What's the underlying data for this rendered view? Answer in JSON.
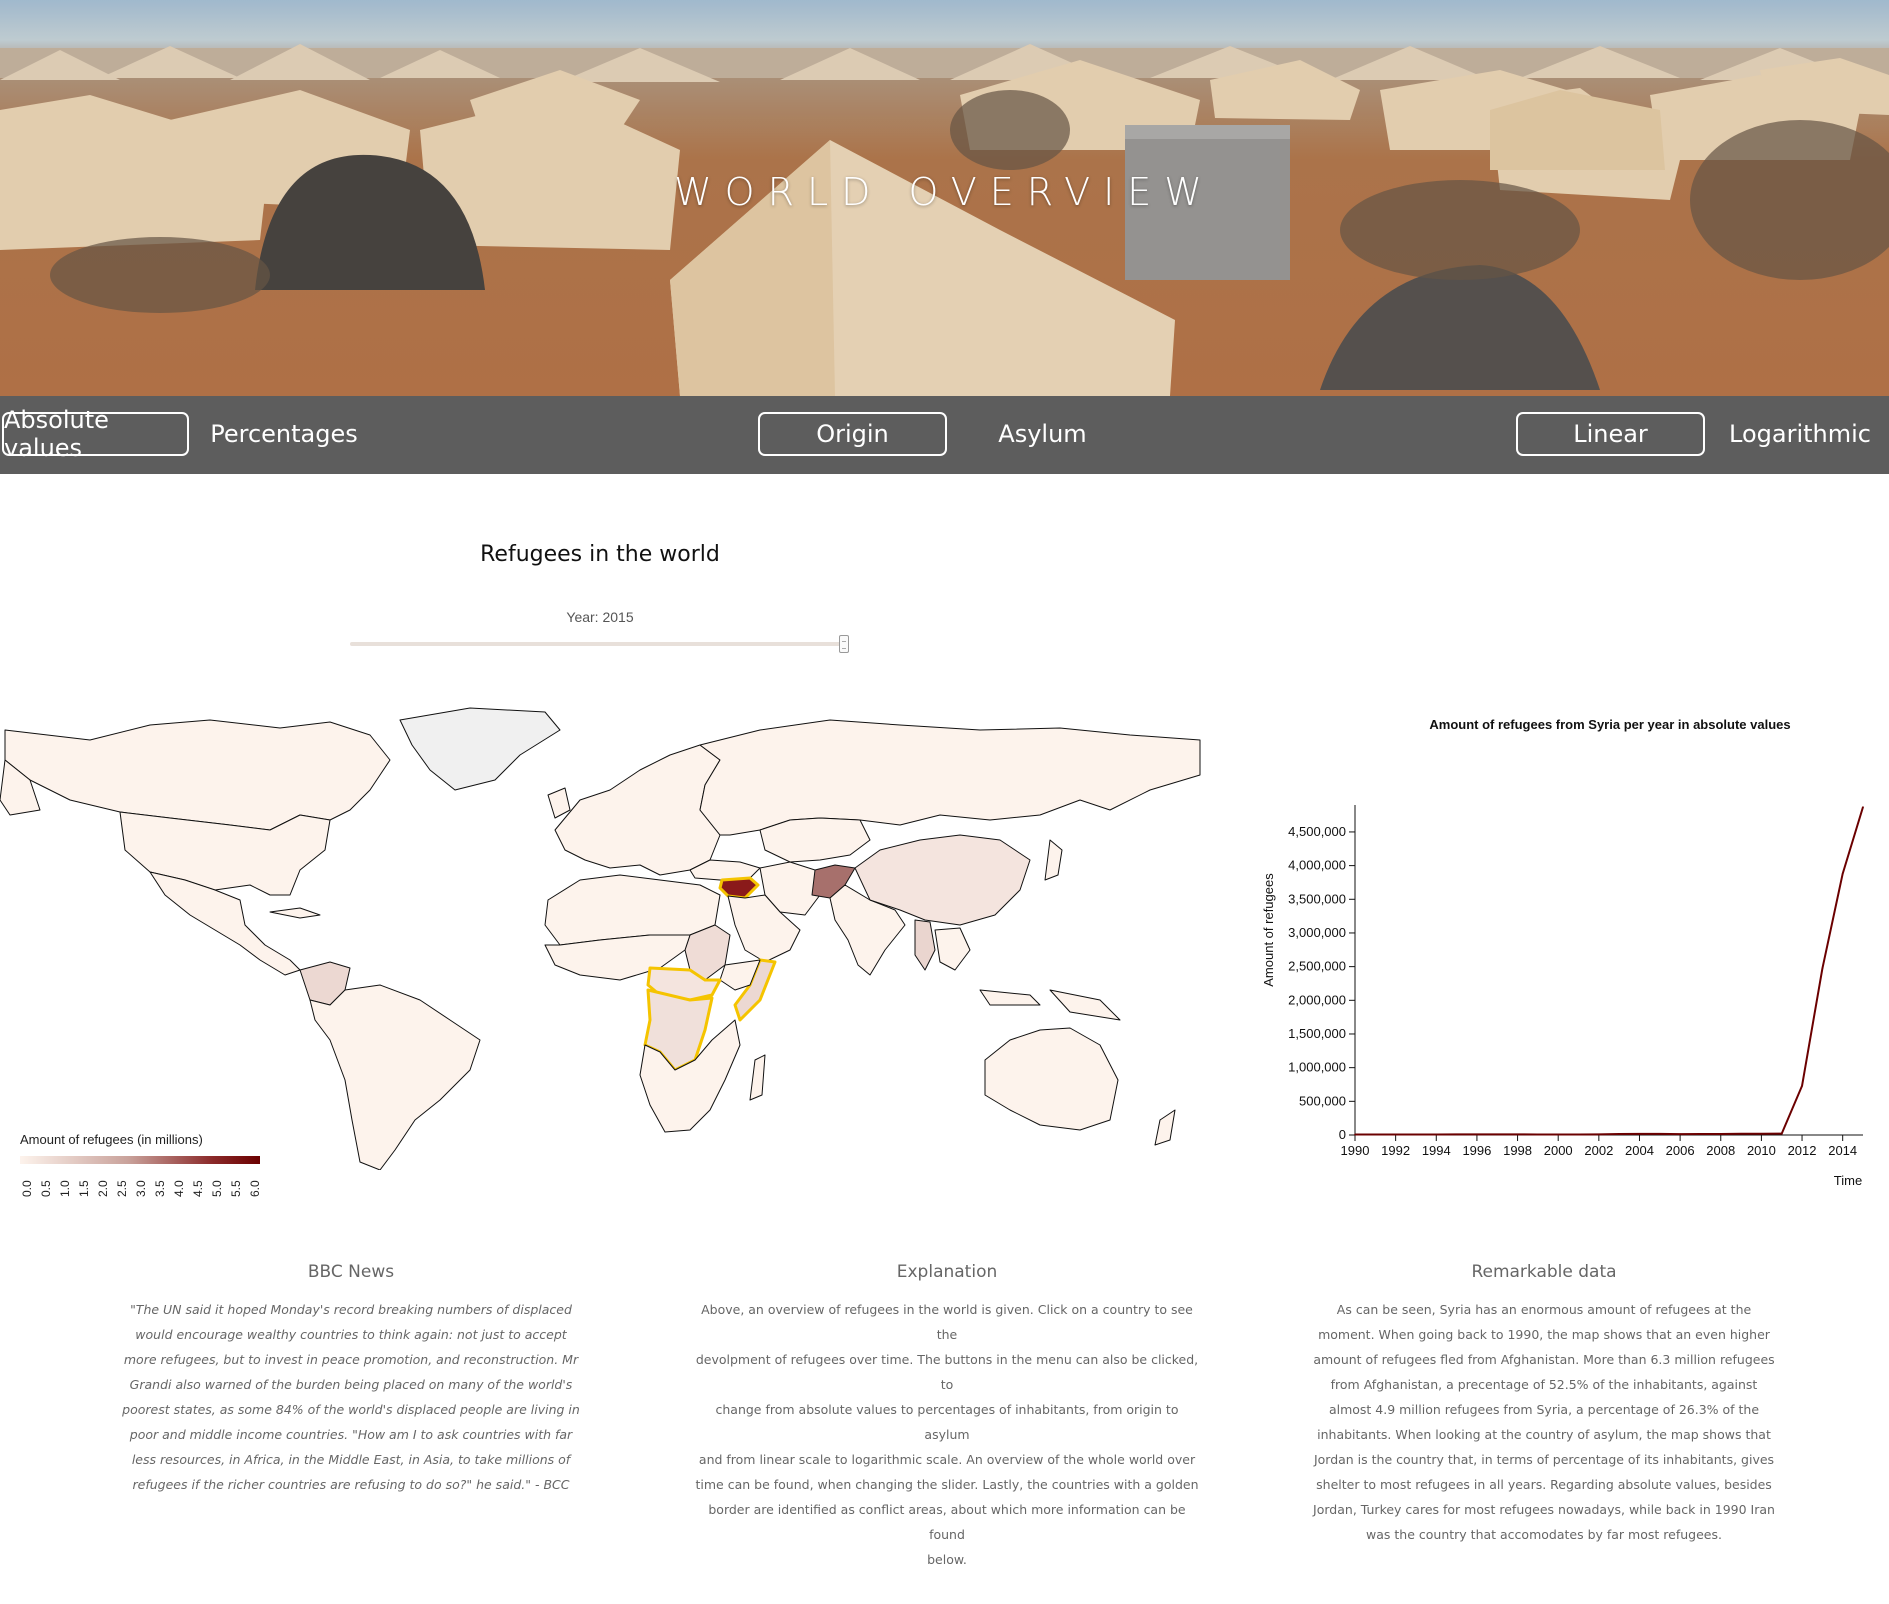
{
  "hero": {
    "title": "WORLD OVERVIEW"
  },
  "menu": {
    "absolute_label": "Absolute values",
    "percentages_label": "Percentages",
    "origin_label": "Origin",
    "asylum_label": "Asylum",
    "linear_label": "Linear",
    "logarithmic_label": "Logarithmic",
    "active": [
      "Absolute values",
      "Origin",
      "Linear"
    ]
  },
  "map": {
    "title": "Refugees in the world",
    "year_label": "Year: 2015",
    "slider_year": 2015,
    "slider_range": [
      1990,
      2015
    ],
    "legend_title": "Amount of refugees (in millions)",
    "legend_ticks": [
      "0.0",
      "0.5",
      "1.0",
      "1.5",
      "2.0",
      "2.5",
      "3.0",
      "3.5",
      "4.0",
      "4.5",
      "5.0",
      "5.5",
      "6.0"
    ],
    "colors": {
      "low": "#fdf3ec",
      "high": "#6b0000",
      "conflict_border": "#f5c400",
      "no_data": "#f0f0f0"
    }
  },
  "chart_data": {
    "type": "line",
    "title": "Amount of refugees from Syria per year in absolute values",
    "xlabel": "Time",
    "ylabel": "Amount of refugees",
    "x_ticks": [
      "1990",
      "1992",
      "1994",
      "1996",
      "1998",
      "2000",
      "2002",
      "2004",
      "2006",
      "2008",
      "2010",
      "2012",
      "2014"
    ],
    "y_ticks": [
      "0",
      "500,000",
      "1,000,000",
      "1,500,000",
      "2,000,000",
      "2,500,000",
      "3,000,000",
      "3,500,000",
      "4,000,000",
      "4,500,000"
    ],
    "xlim": [
      1990,
      2015
    ],
    "ylim": [
      0,
      4900000
    ],
    "series": [
      {
        "x": [
          1990,
          1991,
          1992,
          1993,
          1994,
          1995,
          1996,
          1997,
          1998,
          1999,
          2000,
          2001,
          2002,
          2003,
          2004,
          2005,
          2006,
          2007,
          2008,
          2009,
          2010,
          2011,
          2012,
          2013,
          2014,
          2015
        ],
        "values": [
          8000,
          8000,
          8000,
          8000,
          8000,
          9000,
          10000,
          10000,
          9000,
          8000,
          7000,
          8000,
          10000,
          15000,
          16000,
          16000,
          13000,
          14000,
          15000,
          18000,
          18000,
          20000,
          730000,
          2470000,
          3880000,
          4870000
        ],
        "color": "#6b0000"
      }
    ],
    "grid": false
  },
  "columns": {
    "bbc": {
      "heading": "BBC News",
      "lines": [
        "\"The UN said it hoped Monday's record breaking numbers of displaced",
        "would encourage wealthy countries to think again: not just to accept",
        "more refugees, but to invest in peace promotion, and reconstruction. Mr",
        "Grandi also warned of the burden being placed on many of the world's",
        "poorest states, as some 84% of the world's displaced people are living in",
        "poor and middle income countries. \"How am I to ask countries with far",
        "less resources, in Africa, in the Middle East, in Asia, to take millions of",
        "refugees if the richer countries are refusing to do so?\" he said.\" - BCC"
      ]
    },
    "explanation": {
      "heading": "Explanation",
      "lines": [
        "Above, an overview of refugees in the world is given. Click on a country to see the",
        "devolpment of refugees over time. The buttons in the menu can also be clicked, to",
        "change from absolute values to percentages of inhabitants, from origin to asylum",
        "and from linear scale to logarithmic scale. An overview of the whole world over",
        "time can be found, when changing the slider. Lastly, the countries with a golden",
        "border are identified as conflict areas, about which more information can be found",
        "below."
      ]
    },
    "remarkable": {
      "heading": "Remarkable data",
      "lines": [
        "As can be seen, Syria has an enormous amount of refugees at the",
        "moment. When going back to 1990, the map shows that an even higher",
        "amount of refugees fled from Afghanistan. More than 6.3 million refugees",
        "from Afghanistan, a precentage of 52.5% of the inhabitants, against",
        "almost 4.9 million refugees from Syria, a percentage of 26.3% of the",
        "inhabitants. When looking at the country of asylum, the map shows that",
        "Jordan is the country that, in terms of percentage of its inhabitants, gives",
        "shelter to most refugees in all years. Regarding absolute values, besides",
        "Jordan, Turkey cares for most refugees nowadays, while back in 1990 Iran",
        "was the country that accomodates by far most refugees."
      ]
    }
  }
}
